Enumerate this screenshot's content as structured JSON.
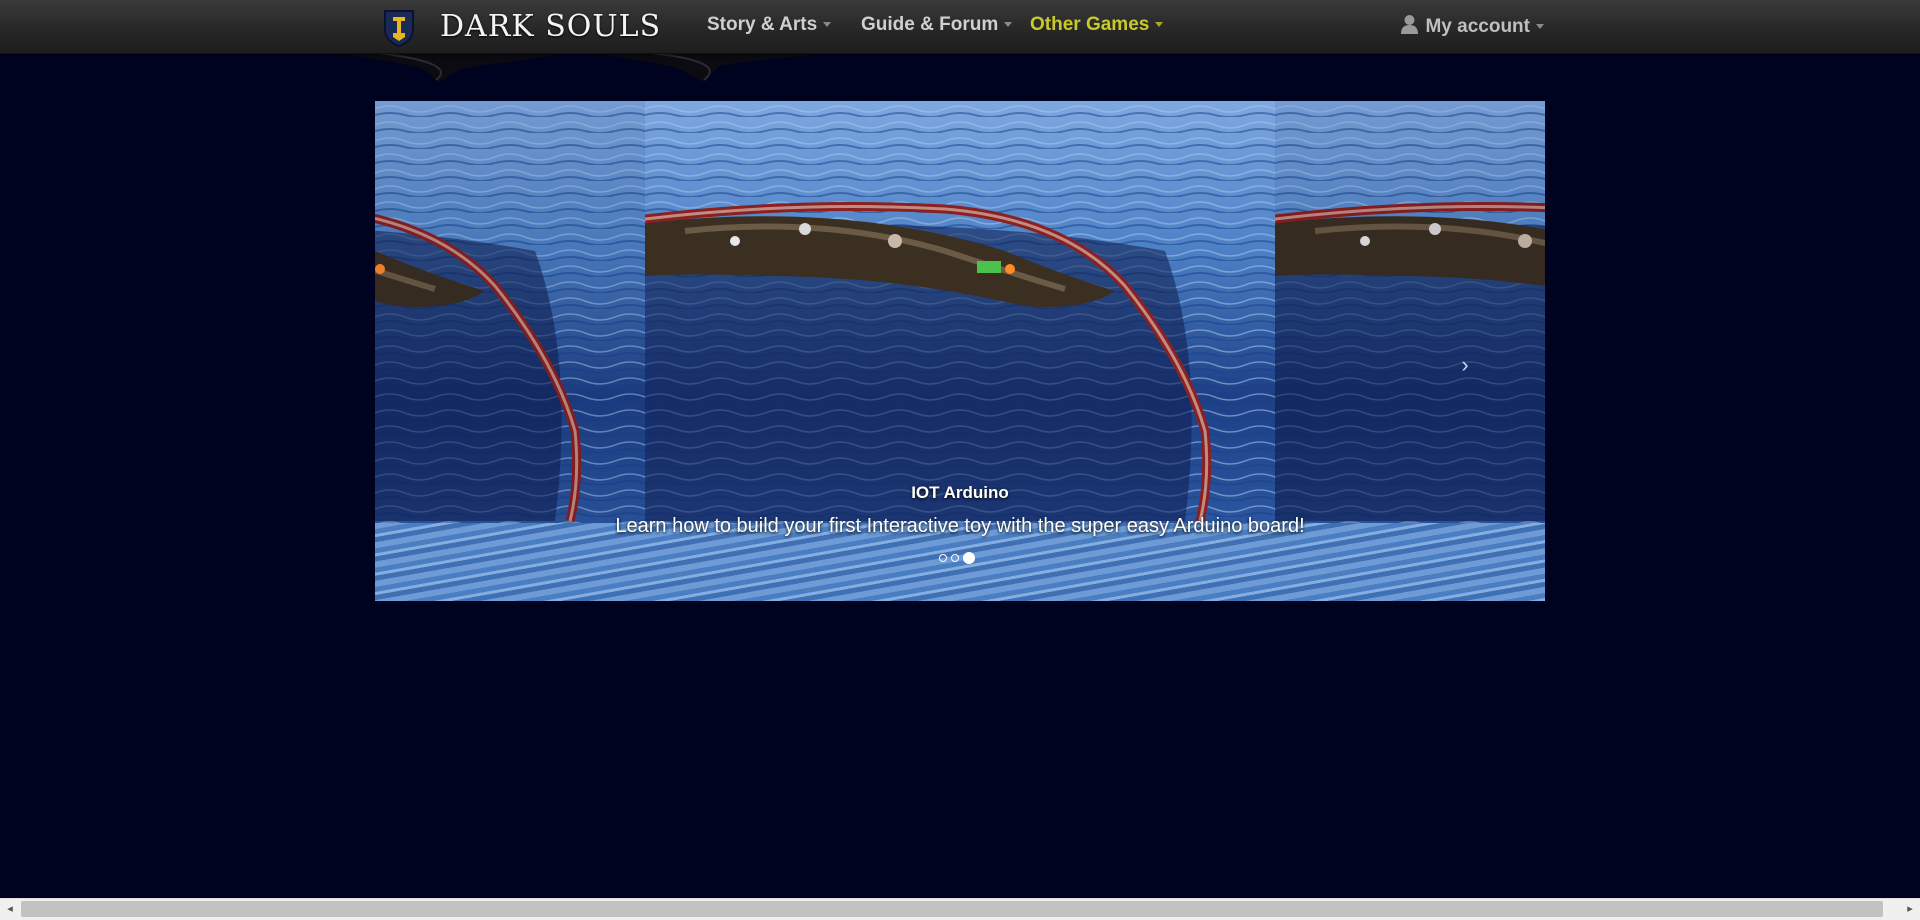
{
  "navbar": {
    "brand": "DARK SOULS",
    "items": [
      {
        "label": "Story & Arts",
        "active": false
      },
      {
        "label": "Guide & Forum",
        "active": false
      },
      {
        "label": "Other Games",
        "active": true
      }
    ],
    "account_label": "My account"
  },
  "carousel": {
    "caption_title": "IOT Arduino",
    "caption_text": "Learn how to build your first Interactive toy with the super easy Arduino board!",
    "indicator_count": 3,
    "active_index": 2,
    "next_icon": "chevron-right-icon"
  },
  "colors": {
    "page_background": "#000320",
    "active_nav": "#c9c92a"
  }
}
